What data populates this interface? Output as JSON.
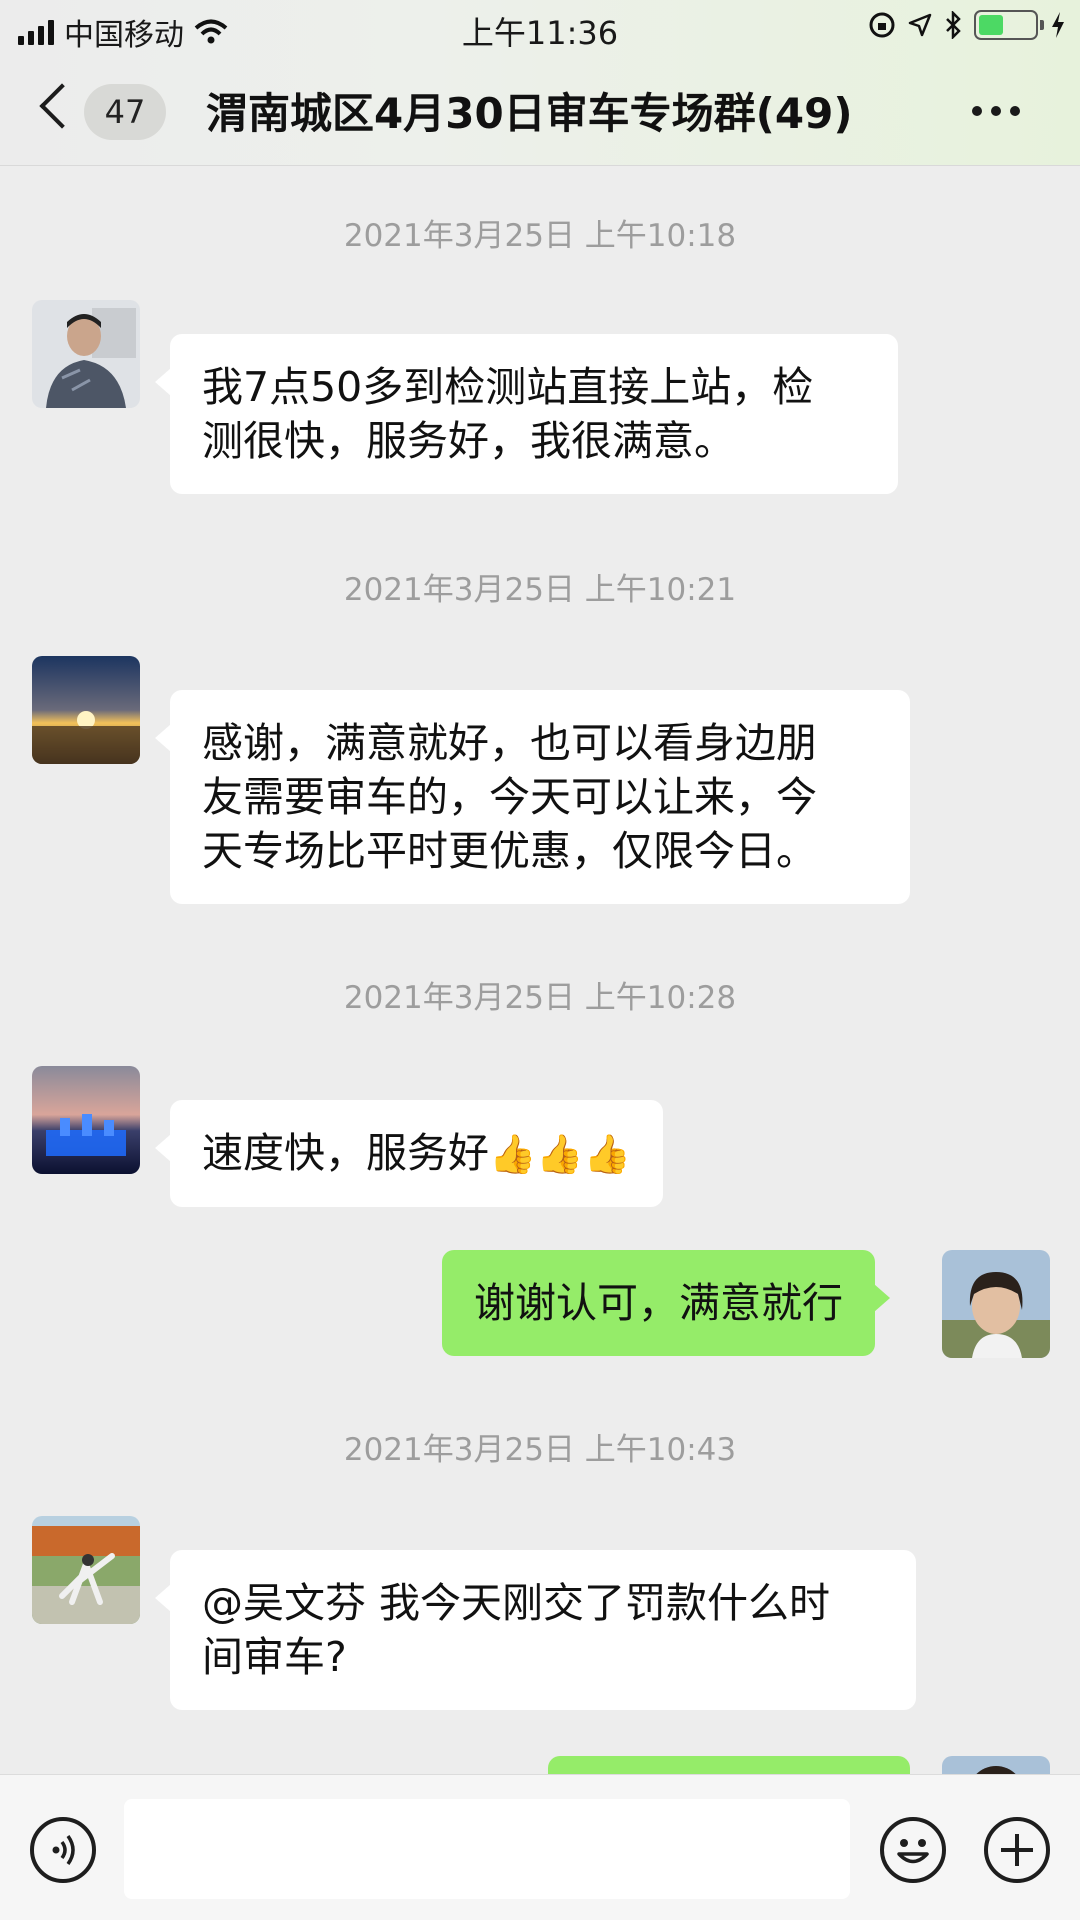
{
  "status_bar": {
    "carrier": "中国移动",
    "time": "上午11:36"
  },
  "nav": {
    "unread": "47",
    "title": "渭南城区4月30日审车专场群(49)"
  },
  "messages": [
    {
      "timestamp": "2021年3月25日 上午10:18",
      "side": "left",
      "line1": "我7点50多到检测站直接上站，检",
      "line2": "测很快，服务好，我很满意。",
      "line3": ""
    },
    {
      "timestamp": "2021年3月25日 上午10:21",
      "side": "left",
      "line1": "感谢，满意就好，也可以看身边朋",
      "line2": "友需要审车的，今天可以让来，今",
      "line3": "天专场比平时更优惠，仅限今日。"
    },
    {
      "timestamp": "2021年3月25日 上午10:28",
      "side": "left",
      "line1": "速度快，服务好",
      "line2": "",
      "line3": ""
    },
    {
      "timestamp": "",
      "side": "right",
      "line1": "谢谢认可，满意就行",
      "line2": "",
      "line3": ""
    },
    {
      "timestamp": "2021年3月25日 上午10:43",
      "side": "left",
      "line1": "@吴文芬 我今天刚交了罚款什么时",
      "line2": "间审车?",
      "line3": ""
    }
  ],
  "emoji": {
    "thumbs_up": "👍"
  },
  "icons": {
    "back": "chevron-left-icon",
    "more": "more-dots-icon",
    "voice": "voice-icon",
    "emoji": "smile-icon",
    "add": "plus-icon"
  },
  "colors": {
    "bubble_mine": "#95ec69",
    "bubble_other": "#ffffff",
    "background": "#ededed"
  }
}
